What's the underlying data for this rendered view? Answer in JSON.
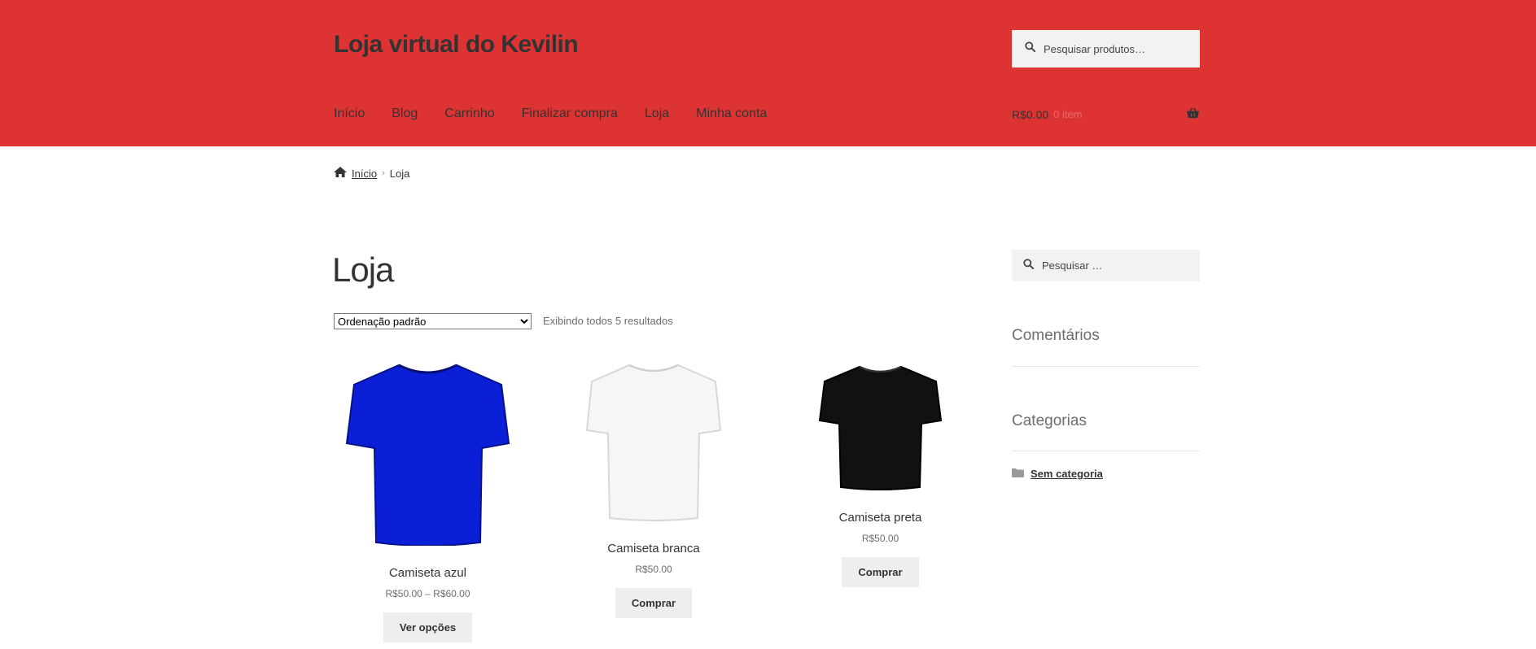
{
  "site": {
    "title": "Loja virtual do Kevilin"
  },
  "header_search": {
    "placeholder": "Pesquisar produtos…"
  },
  "nav": {
    "items": [
      {
        "label": "Início"
      },
      {
        "label": "Blog"
      },
      {
        "label": "Carrinho"
      },
      {
        "label": "Finalizar compra"
      },
      {
        "label": "Loja"
      },
      {
        "label": "Minha conta"
      }
    ]
  },
  "cart": {
    "total": "R$0.00",
    "count": "0 item"
  },
  "breadcrumb": {
    "home": "Início",
    "current": "Loja"
  },
  "page": {
    "title": "Loja"
  },
  "ordering": {
    "selected": "Ordenação padrão"
  },
  "result_count": "Exibindo todos 5 resultados",
  "products": [
    {
      "name": "Camiseta azul",
      "price": "R$50.00 – R$60.00",
      "button": "Ver opções",
      "color": "#0a1fd6"
    },
    {
      "name": "Camiseta branca",
      "price": "R$50.00",
      "button": "Comprar",
      "color": "#f4f4f4"
    },
    {
      "name": "Camiseta preta",
      "price": "R$50.00",
      "button": "Comprar",
      "color": "#111111"
    }
  ],
  "sidebar": {
    "search_placeholder": "Pesquisar …",
    "comments_title": "Comentários",
    "categories_title": "Categorias",
    "category": "Sem categoria"
  },
  "colors": {
    "header_bg": "#dd3333",
    "text_dark": "#333333",
    "button_bg": "#eeeeee"
  }
}
